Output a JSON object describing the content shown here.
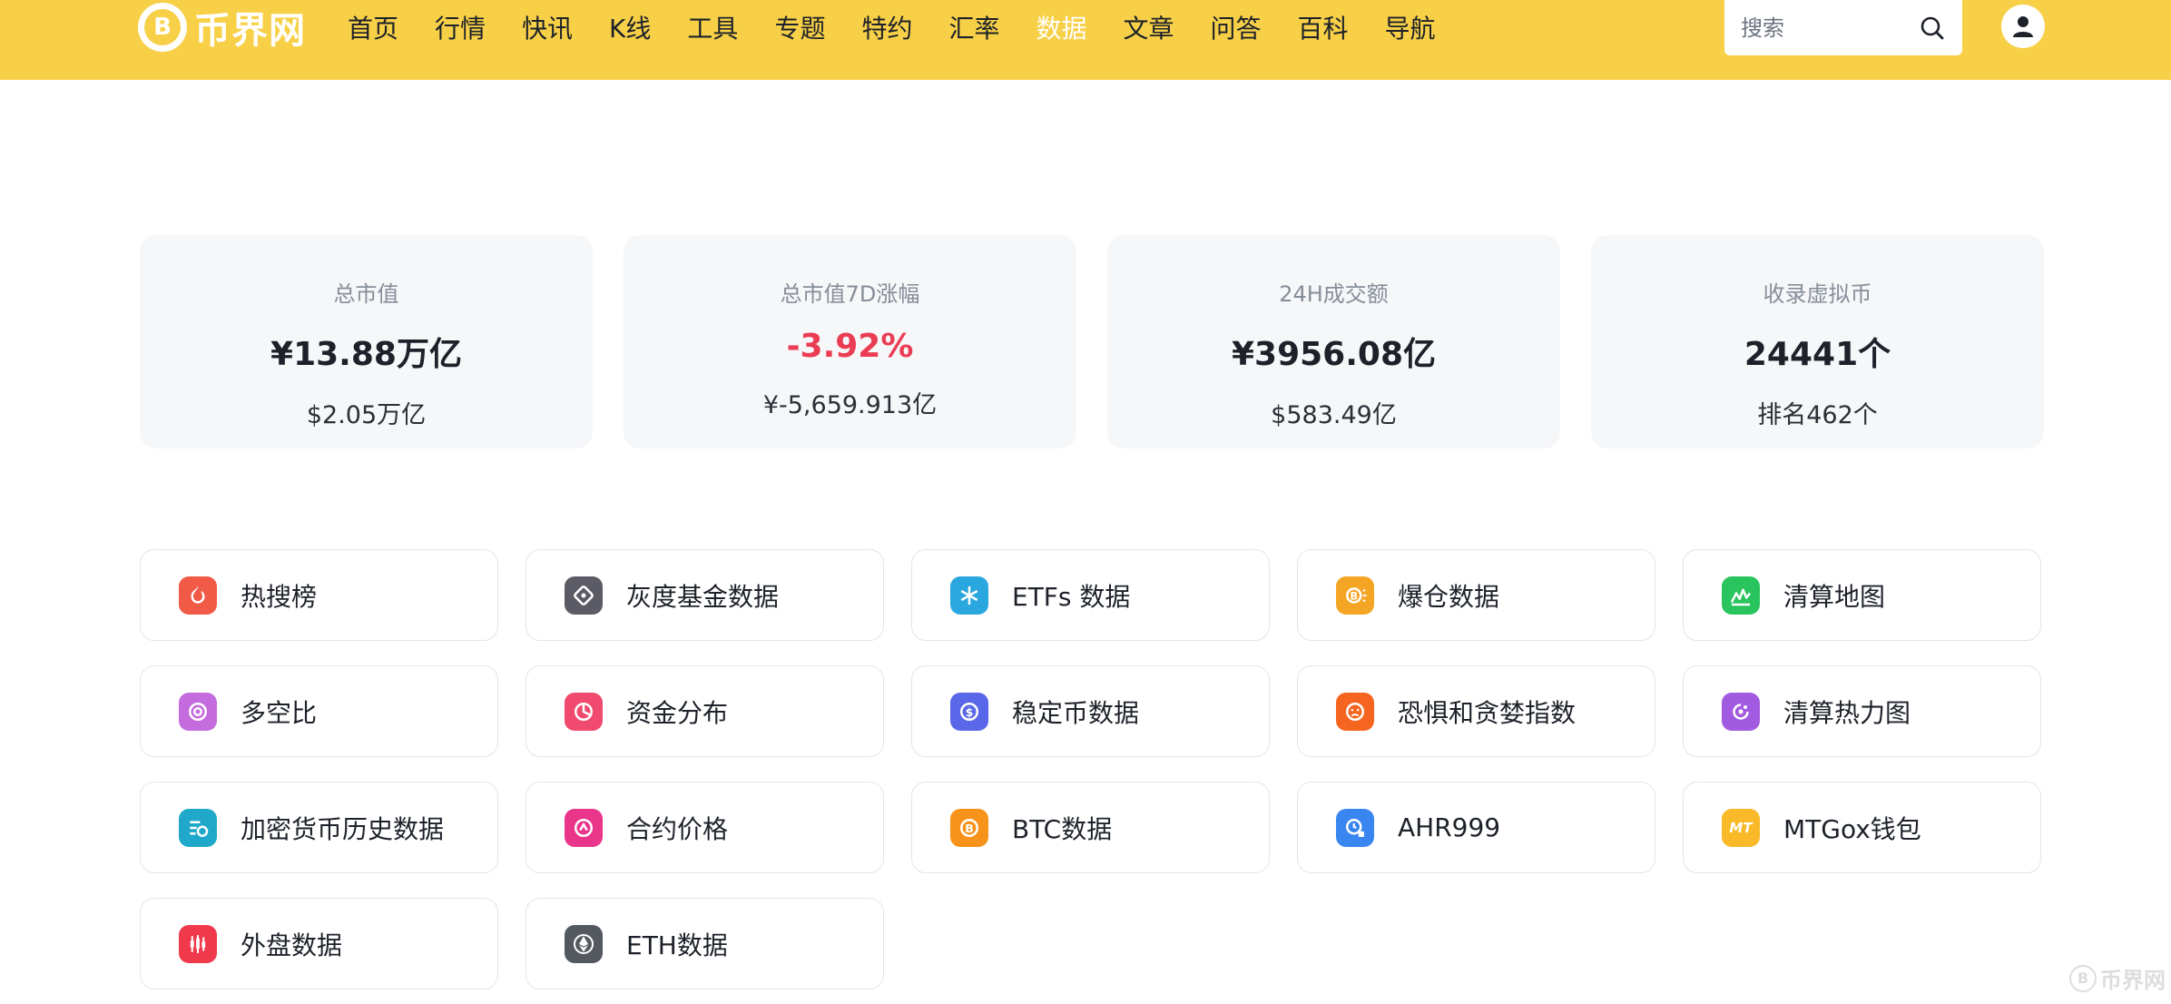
{
  "header": {
    "logo_glyph": "B",
    "logo_text": "币界网",
    "nav": [
      "首页",
      "行情",
      "快讯",
      "K线",
      "工具",
      "专题",
      "特约",
      "汇率",
      "数据",
      "文章",
      "问答",
      "百科",
      "导航"
    ],
    "active_nav": "数据",
    "search_placeholder": "搜索"
  },
  "stats": [
    {
      "label": "总市值",
      "value": "¥13.88万亿",
      "sub": "$2.05万亿"
    },
    {
      "label": "总市值7D涨幅",
      "value": "-3.92%",
      "sub": "¥-5,659.913亿"
    },
    {
      "label": "24H成交额",
      "value": "¥3956.08亿",
      "sub": "$583.49亿"
    },
    {
      "label": "收录虚拟币",
      "value": "24441个",
      "sub": "排名462个"
    }
  ],
  "colors": {
    "header_bg": "#f7d048",
    "negative": "#ea3c53"
  },
  "tools": [
    {
      "label": "热搜榜",
      "icon": "flame-icon",
      "color": "#f25a48"
    },
    {
      "label": "灰度基金数据",
      "icon": "grayscale-icon",
      "color": "#5b5b66"
    },
    {
      "label": "ETFs 数据",
      "icon": "etf-icon",
      "color": "#2aa7df"
    },
    {
      "label": "爆仓数据",
      "icon": "liquidation-icon",
      "color": "#f5a524"
    },
    {
      "label": "清算地图",
      "icon": "liquidation-map-icon",
      "color": "#29c45d"
    },
    {
      "label": "多空比",
      "icon": "long-short-icon",
      "color": "#c46bde"
    },
    {
      "label": "资金分布",
      "icon": "pie-chart-icon",
      "color": "#f04a6e"
    },
    {
      "label": "稳定币数据",
      "icon": "stablecoin-icon",
      "color": "#5a67e8"
    },
    {
      "label": "恐惧和贪婪指数",
      "icon": "fear-greed-icon",
      "color": "#f5651f"
    },
    {
      "label": "清算热力图",
      "icon": "heatmap-icon",
      "color": "#a25be0"
    },
    {
      "label": "加密货币历史数据",
      "icon": "history-icon",
      "color": "#1fa8c9"
    },
    {
      "label": "合约价格",
      "icon": "contract-price-icon",
      "color": "#e9358a"
    },
    {
      "label": "BTC数据",
      "icon": "btc-icon",
      "color": "#f7931a"
    },
    {
      "label": "AHR999",
      "icon": "ahr999-icon",
      "color": "#3a86f0"
    },
    {
      "label": "MTGox钱包",
      "icon": "mtgox-icon",
      "color": "#f9b928",
      "text": "MT"
    },
    {
      "label": "外盘数据",
      "icon": "candlestick-icon",
      "color": "#f03a4c"
    },
    {
      "label": "ETH数据",
      "icon": "eth-icon",
      "color": "#545960"
    }
  ],
  "watermark": "币界网"
}
